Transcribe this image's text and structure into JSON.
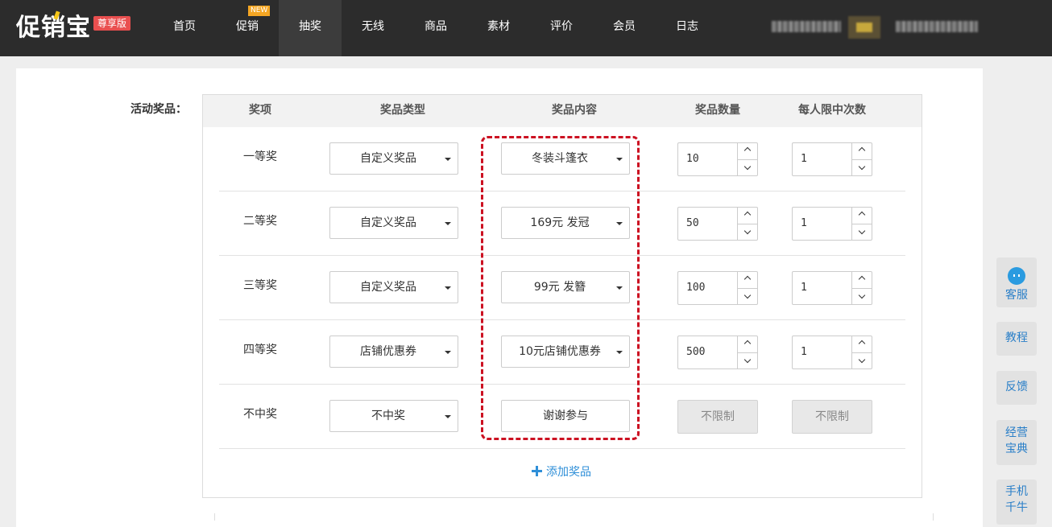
{
  "header": {
    "logo": "促销宝",
    "edition": "尊享版",
    "new_badge": "NEW",
    "nav": [
      "首页",
      "促销",
      "抽奖",
      "无线",
      "商品",
      "素材",
      "评价",
      "会员",
      "日志"
    ],
    "active_nav": "抽奖"
  },
  "form": {
    "prizes_label": "活动奖品：",
    "columns": [
      "奖项",
      "奖品类型",
      "奖品内容",
      "奖品数量",
      "每人限中次数"
    ],
    "rows": [
      {
        "level": "一等奖",
        "type": "自定义奖品",
        "content": "冬装斗篷衣",
        "quantity": "10",
        "limit": "1"
      },
      {
        "level": "二等奖",
        "type": "自定义奖品",
        "content": "169元 发冠",
        "quantity": "50",
        "limit": "1"
      },
      {
        "level": "三等奖",
        "type": "自定义奖品",
        "content": "99元 发簪",
        "quantity": "100",
        "limit": "1"
      },
      {
        "level": "四等奖",
        "type": "店铺优惠券",
        "content": "10元店铺优惠券",
        "quantity": "500",
        "limit": "1"
      },
      {
        "level": "不中奖",
        "type": "不中奖",
        "content": "谢谢参与",
        "quantity": "不限制",
        "limit": "不限制"
      }
    ],
    "add_prize": "添加奖品"
  },
  "side": {
    "service": "客服",
    "tutorial": "教程",
    "feedback": "反馈",
    "guide_line1": "经营",
    "guide_line2": "宝典",
    "mobile_line1": "手机",
    "mobile_line2": "千牛"
  },
  "colors": {
    "topbar": "#2c2c2c",
    "edition_badge": "#e94f4f",
    "highlight_border": "#cc1122",
    "link": "#2f8fd8"
  }
}
